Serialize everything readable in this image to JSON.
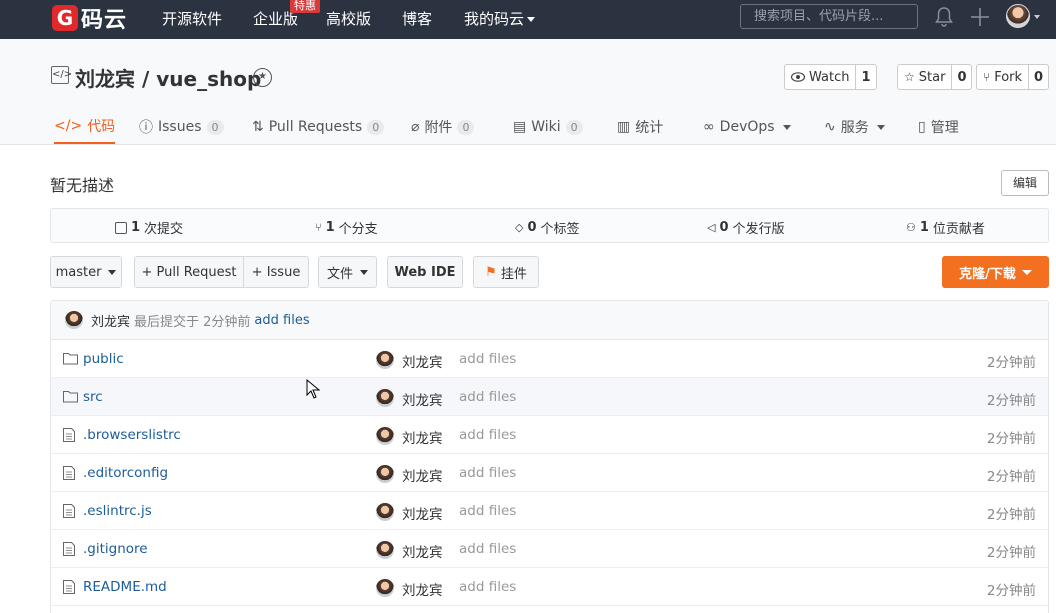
{
  "topnav": {
    "logo_text": "码云",
    "links": [
      "开源软件",
      "企业版",
      "高校版",
      "博客",
      "我的码云"
    ],
    "badge": "特惠",
    "search_placeholder": "搜索项目、代码片段..."
  },
  "repo": {
    "title": "刘龙宾 / vue_shop",
    "watch_label": "Watch",
    "watch_count": "1",
    "star_label": "Star",
    "star_count": "0",
    "fork_label": "Fork",
    "fork_count": "0"
  },
  "tabs": [
    {
      "label": "代码",
      "count": ""
    },
    {
      "label": "Issues",
      "count": "0"
    },
    {
      "label": "Pull Requests",
      "count": "0"
    },
    {
      "label": "附件",
      "count": "0"
    },
    {
      "label": "Wiki",
      "count": "0"
    },
    {
      "label": "统计",
      "count": ""
    },
    {
      "label": "DevOps",
      "count": ""
    },
    {
      "label": "服务",
      "count": ""
    },
    {
      "label": "管理",
      "count": ""
    }
  ],
  "description": "暂无描述",
  "edit_label": "编辑",
  "stats": [
    {
      "num": "1",
      "label": "次提交"
    },
    {
      "num": "1",
      "label": "个分支"
    },
    {
      "num": "0",
      "label": "个标签"
    },
    {
      "num": "0",
      "label": "个发行版"
    },
    {
      "num": "1",
      "label": "位贡献者"
    }
  ],
  "toolbar": {
    "branch": "master",
    "pull_request": "+ Pull Request",
    "issue": "+ Issue",
    "files": "文件",
    "web_ide": "Web IDE",
    "pendant": "挂件",
    "clone": "克隆/下载"
  },
  "last_commit": {
    "author": "刘龙宾",
    "meta": "最后提交于 2分钟前",
    "message": "add files"
  },
  "files": [
    {
      "name": "public",
      "type": "folder",
      "author": "刘龙宾",
      "message": "add files",
      "time": "2分钟前"
    },
    {
      "name": "src",
      "type": "folder",
      "author": "刘龙宾",
      "message": "add files",
      "time": "2分钟前"
    },
    {
      "name": ".browserslistrc",
      "type": "file",
      "author": "刘龙宾",
      "message": "add files",
      "time": "2分钟前"
    },
    {
      "name": ".editorconfig",
      "type": "file",
      "author": "刘龙宾",
      "message": "add files",
      "time": "2分钟前"
    },
    {
      "name": ".eslintrc.js",
      "type": "file",
      "author": "刘龙宾",
      "message": "add files",
      "time": "2分钟前"
    },
    {
      "name": ".gitignore",
      "type": "file",
      "author": "刘龙宾",
      "message": "add files",
      "time": "2分钟前"
    },
    {
      "name": "README.md",
      "type": "file",
      "author": "刘龙宾",
      "message": "add files",
      "time": "2分钟前"
    }
  ]
}
